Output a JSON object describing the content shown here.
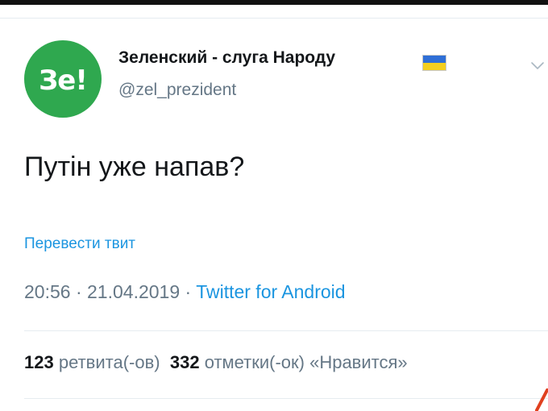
{
  "tweet": {
    "avatar_text": "Зе!",
    "display_name": "Зеленский - слуга Народу",
    "handle": "@zel_prezident",
    "text": "Путін уже напав?",
    "translate_label": "Перевести твит",
    "time": "20:56",
    "separator": "·",
    "date": "21.04.2019",
    "source": "Twitter for Android",
    "retweets_count": "123",
    "retweets_label": "ретвита(-ов)",
    "likes_count": "332",
    "likes_label": "отметки(-ок) «Нравится»"
  },
  "colors": {
    "avatar_bg": "#2fa84f",
    "link": "#1b95e0",
    "secondary_text": "#657786",
    "primary_text": "#14171a",
    "flag_blue": "#2f6fd6",
    "flag_yellow": "#f4cf1f"
  },
  "icons": {
    "flag": "ukraine-flag-icon",
    "menu": "chevron-down-icon"
  }
}
